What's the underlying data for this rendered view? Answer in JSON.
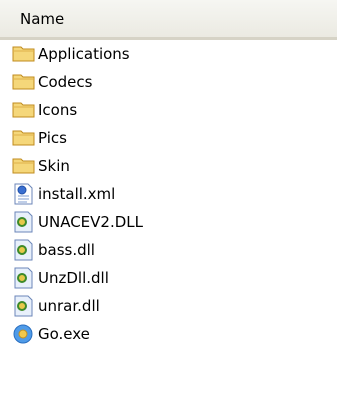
{
  "header": {
    "name_column": "Name"
  },
  "files": [
    {
      "name": "Applications",
      "type": "folder"
    },
    {
      "name": "Codecs",
      "type": "folder"
    },
    {
      "name": "Icons",
      "type": "folder"
    },
    {
      "name": "Pics",
      "type": "folder"
    },
    {
      "name": "Skin",
      "type": "folder"
    },
    {
      "name": "install.xml",
      "type": "xml"
    },
    {
      "name": "UNACEV2.DLL",
      "type": "dll"
    },
    {
      "name": "bass.dll",
      "type": "dll"
    },
    {
      "name": "UnzDll.dll",
      "type": "dll"
    },
    {
      "name": "unrar.dll",
      "type": "dll"
    },
    {
      "name": "Go.exe",
      "type": "exe"
    }
  ],
  "icons": {
    "folder": "folder-icon",
    "xml": "xml-document-icon",
    "dll": "dll-file-icon",
    "exe": "exe-file-icon"
  },
  "colors": {
    "folder_fill": "#f5d77a",
    "folder_stroke": "#c08b1e",
    "header_border": "#d6d3c6"
  }
}
